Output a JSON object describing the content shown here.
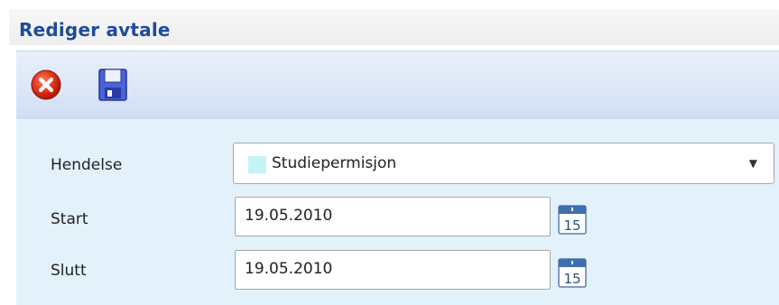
{
  "window": {
    "title": "Rediger avtale"
  },
  "toolbar": {
    "cancel_icon": "close-circle-icon",
    "save_icon": "floppy-disk-icon"
  },
  "form": {
    "event_label": "Hendelse",
    "event_value": "Studiepermisjon",
    "event_color": "#c6f3f6",
    "start_label": "Start",
    "start_value": "19.05.2010",
    "end_label": "Slutt",
    "end_value": "19.05.2010",
    "calendar_icon": "calendar-icon",
    "calendar_day": "15"
  },
  "colors": {
    "title": "#1e4b9b",
    "toolbar": "#dbe6f7",
    "panel": "#e3f1fb"
  }
}
